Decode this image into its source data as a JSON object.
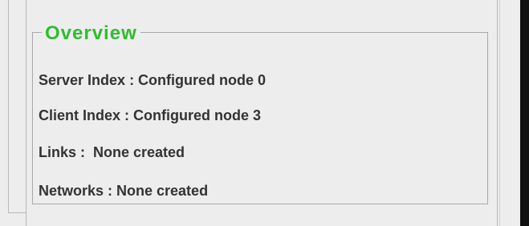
{
  "overview": {
    "title": "Overview",
    "rows": [
      "Server Index : Configured node 0",
      "Client Index : Configured node 3",
      "Links :  None created",
      "Networks : None created"
    ]
  }
}
